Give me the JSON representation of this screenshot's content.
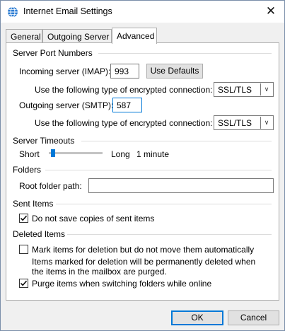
{
  "window": {
    "title": "Internet Email Settings"
  },
  "tabs": [
    {
      "label": "General"
    },
    {
      "label": "Outgoing Server"
    },
    {
      "label": "Advanced"
    }
  ],
  "server_ports": {
    "heading": "Server Port Numbers",
    "incoming_label": "Incoming server (IMAP):",
    "incoming_value": "993",
    "use_defaults": "Use Defaults",
    "encryption_label_in": "Use the following type of encrypted connection:",
    "encryption_in_value": "SSL/TLS",
    "outgoing_label": "Outgoing server (SMTP):",
    "outgoing_value": "587",
    "encryption_label_out": "Use the following type of encrypted connection:",
    "encryption_out_value": "SSL/TLS"
  },
  "timeouts": {
    "heading": "Server Timeouts",
    "short": "Short",
    "long": "Long",
    "value": "1 minute",
    "level": 0.0
  },
  "folders": {
    "heading": "Folders",
    "root_label": "Root folder path:",
    "root_value": ""
  },
  "sent_items": {
    "heading": "Sent Items",
    "no_save_label": "Do not save copies of sent items",
    "no_save_checked": true
  },
  "deleted_items": {
    "heading": "Deleted Items",
    "mark_label": "Mark items for deletion but do not move them automatically",
    "mark_checked": false,
    "note": "Items marked for deletion will be permanently deleted when the items in the mailbox are purged.",
    "purge_label": "Purge items when switching folders while online",
    "purge_checked": true
  },
  "footer": {
    "ok": "OK",
    "cancel": "Cancel"
  }
}
